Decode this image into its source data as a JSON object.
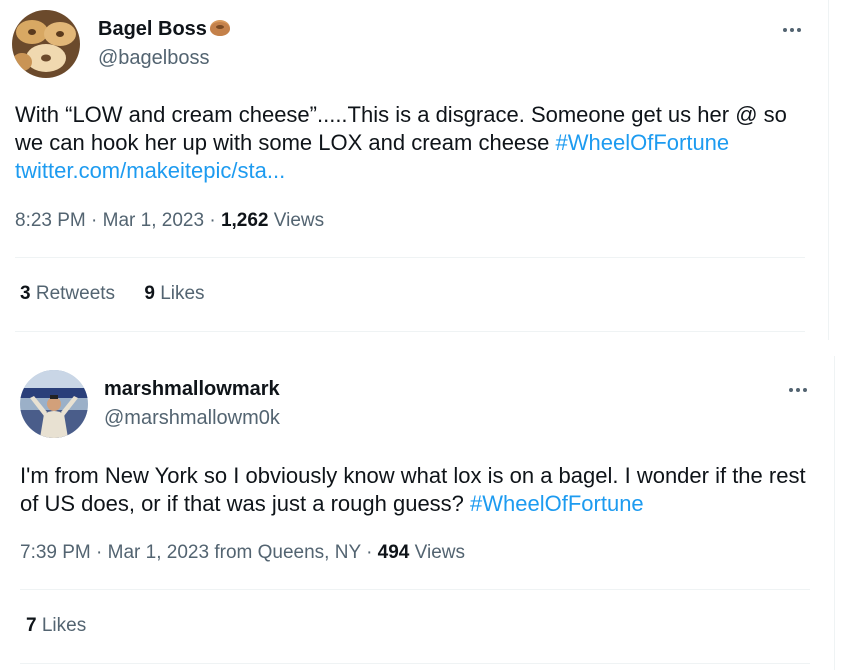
{
  "tweets": [
    {
      "display_name": "Bagel Boss",
      "handle": "@bagelboss",
      "text_plain": "With “LOW and cream cheese”.....This is a disgrace. Someone get us her @ so we can hook her up with some LOX and cream cheese ",
      "hashtag": "#WheelOfFortune",
      "link": "twitter.com/makeitepic/sta...",
      "time": "8:23 PM",
      "date": "Mar 1, 2023",
      "views_count": "1,262",
      "views_label": "Views",
      "retweets_count": "3",
      "retweets_label": "Retweets",
      "likes_count": "9",
      "likes_label": "Likes",
      "name_emoji": "bagel-icon"
    },
    {
      "display_name": "marshmallowmark",
      "handle": "@marshmallowm0k",
      "text_plain": "I'm from New York so I obviously know what lox is on a bagel. I wonder if the rest of US does, or if that was just a rough guess? ",
      "hashtag": "#WheelOfFortune",
      "time": "7:39 PM",
      "date": "Mar 1, 2023",
      "location": "from Queens, NY",
      "views_count": "494",
      "views_label": "Views",
      "likes_count": "7",
      "likes_label": "Likes"
    }
  ],
  "separator_dot": "·",
  "colors": {
    "link": "#1d9bf0",
    "secondary": "#536471",
    "text": "#0f1419"
  }
}
